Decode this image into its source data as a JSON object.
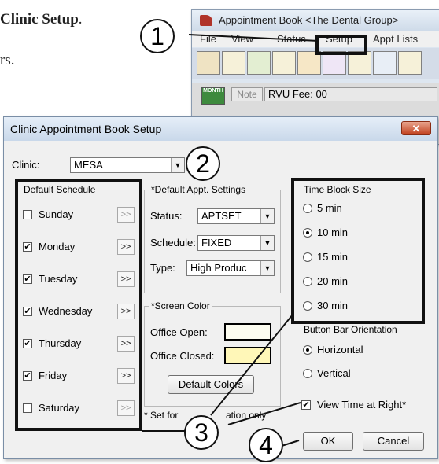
{
  "doc": {
    "heading_fragment": "Clinic Setup",
    "heading_period": ".",
    "text_fragment": "rs."
  },
  "app": {
    "title": "Appointment Book <The Dental Group>",
    "menu": [
      "File",
      "View",
      "Status",
      "Setup",
      "Appt Lists"
    ],
    "month_label": "MONTH",
    "note_label": "Note",
    "rvu_fee": "RVU Fee: 00"
  },
  "dialog": {
    "title": "Clinic Appointment Book Setup",
    "close": "✕",
    "clinic_label": "Clinic:",
    "clinic_value": "MESA",
    "schedule": {
      "legend": "Default Schedule",
      "days": [
        {
          "label": "Sunday",
          "checked": false
        },
        {
          "label": "Monday",
          "checked": true
        },
        {
          "label": "Tuesday",
          "checked": true
        },
        {
          "label": "Wednesday",
          "checked": true
        },
        {
          "label": "Thursday",
          "checked": true
        },
        {
          "label": "Friday",
          "checked": true
        },
        {
          "label": "Saturday",
          "checked": false
        }
      ],
      "chevron": ">>"
    },
    "appt": {
      "legend": "*Default Appt. Settings",
      "status_label": "Status:",
      "status_value": "APTSET",
      "schedule_label": "Schedule:",
      "schedule_value": "FIXED",
      "type_label": "Type:",
      "type_value": "High Produc"
    },
    "screen": {
      "legend": "*Screen Color",
      "open_label": "Office Open:",
      "closed_label": "Office Closed:",
      "open_color": "#fcfcf0",
      "closed_color": "#fff7b8",
      "default_btn": "Default Colors"
    },
    "footnote_a": "* Set for",
    "footnote_b": "ation only",
    "timeblock": {
      "legend": "Time Block Size",
      "options": [
        "5 min",
        "10 min",
        "15 min",
        "20 min",
        "30 min"
      ],
      "selected": "10 min"
    },
    "orientation": {
      "legend": "Button Bar Orientation",
      "options": [
        "Horizontal",
        "Vertical"
      ],
      "selected": "Horizontal"
    },
    "view_time_right": "View Time at Right*",
    "ok": "OK",
    "cancel": "Cancel"
  },
  "callouts": [
    "1",
    "2",
    "3",
    "4"
  ]
}
